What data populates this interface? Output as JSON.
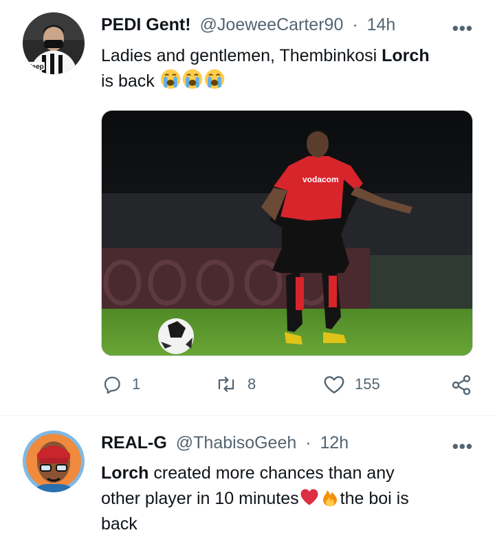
{
  "tweets": [
    {
      "display_name": "PEDI Gent!",
      "handle": "@JoeweeCarter90",
      "separator": "·",
      "time": "14h",
      "more": "•••",
      "text_pre": "Ladies and gentlemen, Thembinkosi ",
      "text_bold": "Lorch",
      "text_line2": "is back",
      "emojis": [
        "loudly-crying-face",
        "loudly-crying-face",
        "loudly-crying-face"
      ],
      "avatar_jersey_text": "Jeep",
      "photo_shirt_text": "vodacom",
      "actions": {
        "reply_count": "1",
        "retweet_count": "8",
        "like_count": "155"
      }
    },
    {
      "display_name": "REAL-G",
      "handle": "@ThabisoGeeh",
      "separator": "·",
      "time": "12h",
      "more": "•••",
      "text_bold": "Lorch",
      "text_rest": " created more chances than any",
      "text_line2": "other player in 10 minutes",
      "text_after_emoji": "the boi is",
      "text_line3": "back",
      "emojis": [
        "red-heart",
        "fire"
      ]
    }
  ],
  "colors": {
    "text": "#0f1419",
    "muted": "#536471",
    "divider": "#eff3f4",
    "pitch": "#5f9a2e",
    "kit_red": "#d8242b"
  }
}
